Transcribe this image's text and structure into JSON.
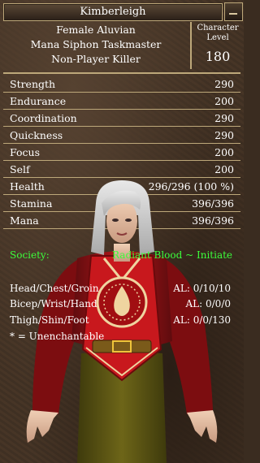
{
  "window": {
    "title": "Kimberleigh"
  },
  "header": {
    "lines": [
      "Female Aluvian",
      "Mana Siphon Taskmaster",
      "Non-Player Killer"
    ],
    "level_label_line1": "Character",
    "level_label_line2": "Level",
    "level_value": "180"
  },
  "stats": [
    {
      "name": "Strength",
      "value": "290"
    },
    {
      "name": "Endurance",
      "value": "200"
    },
    {
      "name": "Coordination",
      "value": "290"
    },
    {
      "name": "Quickness",
      "value": "290"
    },
    {
      "name": "Focus",
      "value": "200"
    },
    {
      "name": "Self",
      "value": "200"
    },
    {
      "name": "Health",
      "value": "296/296 (100 %)"
    },
    {
      "name": "Stamina",
      "value": "396/396"
    },
    {
      "name": "Mana",
      "value": "396/396"
    }
  ],
  "society": {
    "label": "Society:",
    "value": "Radiant Blood ~ Initiate"
  },
  "armor": [
    {
      "label": "Head/Chest/Groin",
      "value": "AL: 0/10/10"
    },
    {
      "label": "Bicep/Wrist/Hand",
      "value": "AL: 0/0/0"
    },
    {
      "label": "Thigh/Shin/Foot",
      "value": "AL: 0/0/130"
    }
  ],
  "footnote": "* = Unenchantable",
  "icons": {
    "minimize": "minimize-icon"
  },
  "colors": {
    "accent": "#bda87a",
    "society": "#3cfe3c"
  }
}
